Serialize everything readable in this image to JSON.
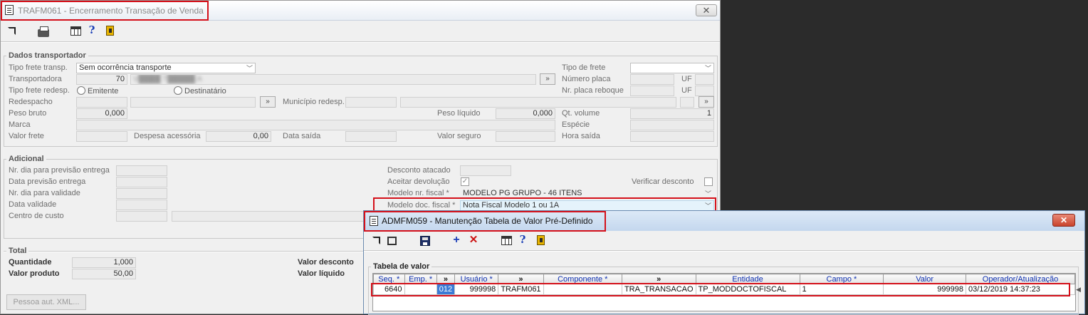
{
  "window_main": {
    "title": "TRAFM061 - Encerramento Transação de Venda",
    "close_label": "✕",
    "section_transportador": "Dados transportador",
    "labels": {
      "tipo_frete_transp": "Tipo frete transp.",
      "transportadora": "Transportadora",
      "tipo_frete_redesp": "Tipo frete redesp.",
      "redespacho": "Redespacho",
      "municipio_redesp": "Município redesp.",
      "peso_bruto": "Peso bruto",
      "peso_liquido": "Peso líquido",
      "marca": "Marca",
      "valor_frete": "Valor frete",
      "despesa_acessoria": "Despesa acessória",
      "data_saida": "Data saída",
      "valor_seguro": "Valor seguro",
      "tipo_de_frete": "Tipo de frete",
      "numero_placa": "Número placa",
      "nr_placa_reboque": "Nr. placa reboque",
      "uf": "UF",
      "qt_volume": "Qt. volume",
      "especie": "Espécie",
      "hora_saida": "Hora saída"
    },
    "values": {
      "tipo_frete_transp": "Sem ocorrência transporte",
      "transportadora_code": "70",
      "transportadora_name": "V████ T█████ A",
      "peso_bruto": "0,000",
      "peso_liquido": "0,000",
      "despesa_acessoria": "0,00",
      "qt_volume": "1"
    },
    "radio": {
      "emitente": "Emitente",
      "destinatario": "Destinatário"
    },
    "lookup_button": "»",
    "section_adicional": "Adicional",
    "adicional_labels": {
      "nr_dia_previsao": "Nr. dia para previsão entrega",
      "data_previsao": "Data previsão entrega",
      "nr_dia_validade": "Nr. dia para validade",
      "data_validade": "Data validade",
      "centro_custo": "Centro de custo",
      "desconto_atacado": "Desconto atacado",
      "aceitar_devolucao": "Aceitar devolução",
      "verificar_desconto": "Verificar desconto",
      "modelo_nr_fiscal": "Modelo nr. fiscal *",
      "modelo_doc_fiscal": "Modelo doc. fiscal *"
    },
    "adicional_values": {
      "modelo_nr_fiscal": "MODELO PG GRUPO - 46 ITENS",
      "modelo_doc_fiscal": "Nota Fiscal Modelo 1 ou 1A"
    },
    "section_total": "Total",
    "total_labels": {
      "quantidade": "Quantidade",
      "valor_produto": "Valor produto",
      "valor_desconto": "Valor desconto",
      "valor_liquido": "Valor líquido"
    },
    "total_values": {
      "quantidade": "1,000",
      "valor_produto": "50,00"
    },
    "pessoa_button": "Pessoa aut. XML..."
  },
  "window_popup": {
    "title": "ADMFM059 - Manutenção Tabela de Valor Pré-Definido",
    "close_label": "✕",
    "section_label": "Tabela de valor",
    "columns": [
      "Seq. *",
      "Emp. *",
      "»",
      "Usuário *",
      "»",
      "Componente *",
      "»",
      "Entidade",
      "Campo *",
      "Valor",
      "Operador/Atualização"
    ],
    "rows": [
      [
        "6640",
        "",
        "012",
        "999998",
        "TRAFM061",
        "",
        "TRA_TRANSACAO",
        "TP_MODDOCTOFISCAL",
        "1",
        "999998",
        "03/12/2019 14:37:23"
      ]
    ]
  }
}
